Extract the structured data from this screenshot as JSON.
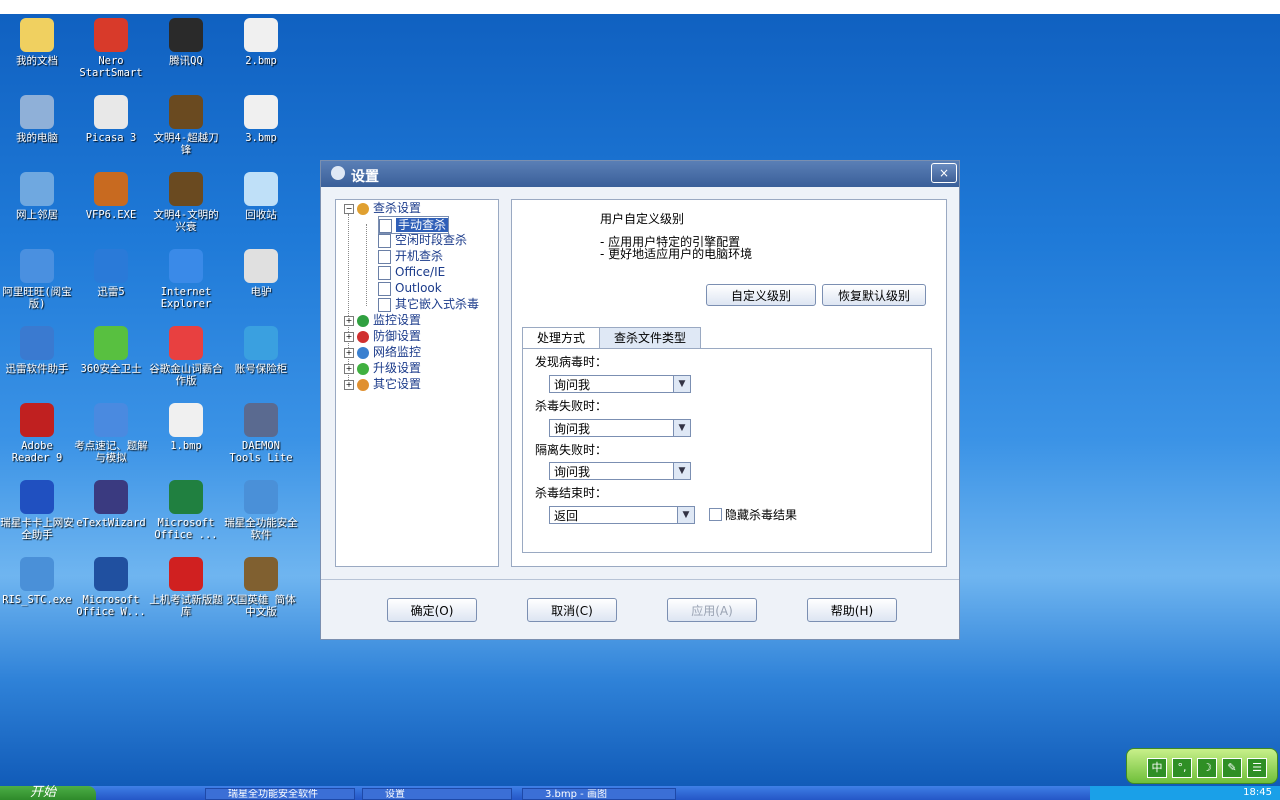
{
  "desktop_icons": [
    {
      "label": "我的文档",
      "color": "#f0d060"
    },
    {
      "label": "Nero StartSmart",
      "color": "#d83a2a"
    },
    {
      "label": "腾讯QQ",
      "color": "#2a2a2a"
    },
    {
      "label": "2.bmp",
      "color": "#f0f0f0"
    },
    {
      "label": "我的电脑",
      "color": "#8fb0d8"
    },
    {
      "label": "Picasa 3",
      "color": "#e8e8e8"
    },
    {
      "label": "文明4-超越刀锋",
      "color": "#6a4a20"
    },
    {
      "label": "3.bmp",
      "color": "#f0f0f0"
    },
    {
      "label": "网上邻居",
      "color": "#6fa8e0"
    },
    {
      "label": "VFP6.EXE",
      "color": "#c86a20"
    },
    {
      "label": "文明4-文明的兴衰",
      "color": "#6a4a20"
    },
    {
      "label": "回收站",
      "color": "#bfe0f8"
    },
    {
      "label": "阿里旺旺(阅宝版)",
      "color": "#4a90e0"
    },
    {
      "label": "迅雷5",
      "color": "#2a7ad8"
    },
    {
      "label": "Internet Explorer",
      "color": "#3a8ae8"
    },
    {
      "label": "电驴",
      "color": "#e0e0e0"
    },
    {
      "label": "迅雷软件助手",
      "color": "#3a7ad0"
    },
    {
      "label": "360安全卫士",
      "color": "#58c040"
    },
    {
      "label": "谷歌金山词霸合作版",
      "color": "#e84040"
    },
    {
      "label": "账号保险柜",
      "color": "#3aa0e0"
    },
    {
      "label": "Adobe Reader 9",
      "color": "#c02020"
    },
    {
      "label": "考点速记、题解与模拟",
      "color": "#4a8ae0"
    },
    {
      "label": "1.bmp",
      "color": "#f0f0f0"
    },
    {
      "label": "DAEMON Tools Lite",
      "color": "#5a6a90"
    },
    {
      "label": "瑞星卡卡上网安全助手",
      "color": "#2050c0"
    },
    {
      "label": "eTextWizard",
      "color": "#3a3a80"
    },
    {
      "label": "Microsoft Office ...",
      "color": "#208040"
    },
    {
      "label": "瑞星全功能安全软件",
      "color": "#4a90d8"
    },
    {
      "label": "RIS_STC.exe",
      "color": "#4a90d8"
    },
    {
      "label": "Microsoft Office W...",
      "color": "#2050a0"
    },
    {
      "label": "上机考试新版题库",
      "color": "#d02020"
    },
    {
      "label": "灭国英雄 简体中文版",
      "color": "#806030"
    }
  ],
  "window": {
    "title": "设置",
    "close": "×",
    "tree": {
      "root": "查杀设置",
      "children": [
        "手动查杀",
        "空闲时段查杀",
        "开机查杀",
        "Office/IE",
        "Outlook",
        "其它嵌入式杀毒"
      ],
      "others": [
        "监控设置",
        "防御设置",
        "网络监控",
        "升级设置",
        "其它设置"
      ]
    },
    "panel": {
      "title": "用户自定义级别",
      "desc1": "- 应用用户特定的引擎配置",
      "desc2": "- 更好地适应用户的电脑环境",
      "btn_custom": "自定义级别",
      "btn_restore": "恢复默认级别",
      "tab1": "处理方式",
      "tab2": "查杀文件类型",
      "field1_label": "发现病毒时：",
      "field1_value": "询问我",
      "field2_label": "杀毒失败时：",
      "field2_value": "询问我",
      "field3_label": "隔离失败时：",
      "field3_value": "询问我",
      "field4_label": "杀毒结束时：",
      "field4_value": "返回",
      "checkbox_label": "隐藏杀毒结果"
    },
    "footer": {
      "ok": "确定(O)",
      "cancel": "取消(C)",
      "apply": "应用(A)",
      "help": "帮助(H)"
    }
  },
  "taskbar": {
    "start": "开始",
    "items": [
      "瑞星全功能安全软件",
      "设置",
      "3.bmp - 画图"
    ],
    "clock": "18:45"
  },
  "ime": [
    "中",
    "°,",
    "☽",
    "✎",
    "☰"
  ]
}
